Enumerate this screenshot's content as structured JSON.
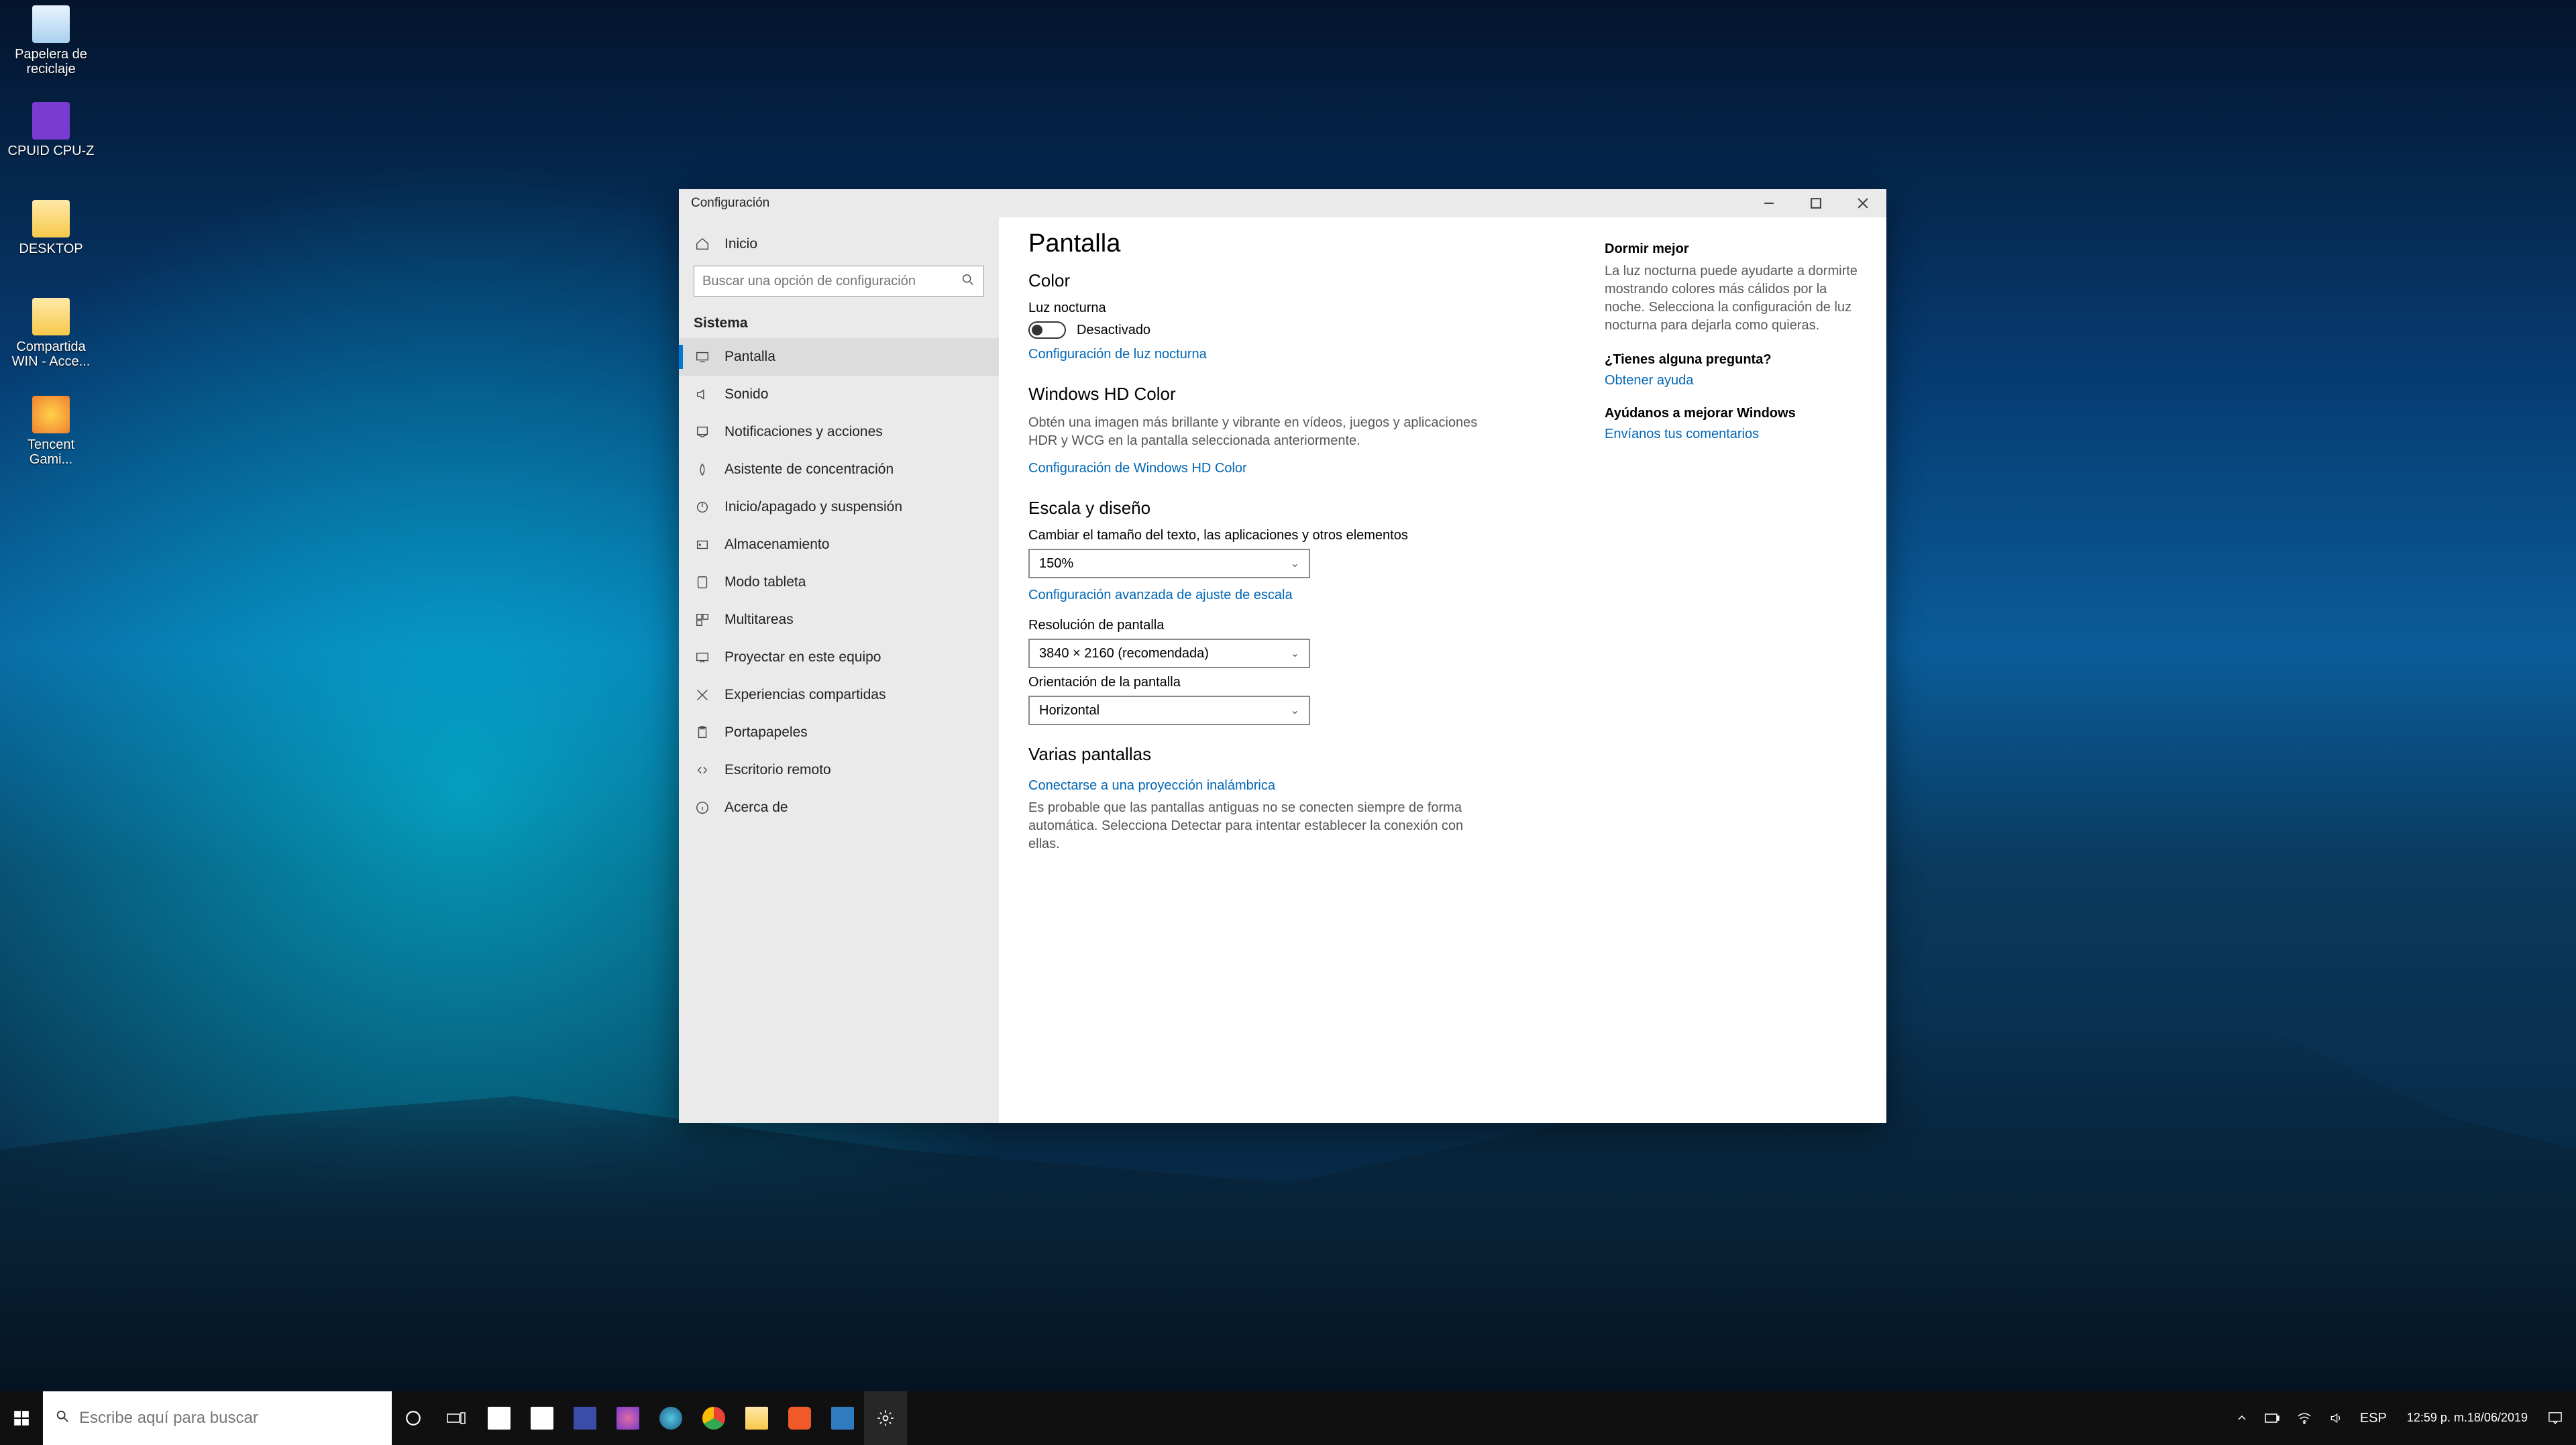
{
  "desktop_icons": [
    {
      "label": "Papelera de reciclaje",
      "color": "#cfe8ff"
    },
    {
      "label": "CPUID CPU-Z",
      "color": "#7a3bd1"
    },
    {
      "label": "DESKTOP",
      "color": "#ffe27a"
    },
    {
      "label": "Compartida WIN - Acce...",
      "color": "#ffe27a"
    },
    {
      "label": "Tencent Gami...",
      "color": "#ffb030"
    }
  ],
  "window": {
    "title": "Configuración",
    "home": "Inicio",
    "search_placeholder": "Buscar una opción de configuración",
    "section": "Sistema",
    "nav": [
      "Pantalla",
      "Sonido",
      "Notificaciones y acciones",
      "Asistente de concentración",
      "Inicio/apagado y suspensión",
      "Almacenamiento",
      "Modo tableta",
      "Multitareas",
      "Proyectar en este equipo",
      "Experiencias compartidas",
      "Portapapeles",
      "Escritorio remoto",
      "Acerca de"
    ],
    "page": {
      "title": "Pantalla",
      "color_h": "Color",
      "nightlight_label": "Luz nocturna",
      "nightlight_state": "Desactivado",
      "nightlight_link": "Configuración de luz nocturna",
      "hd_h": "Windows HD Color",
      "hd_desc": "Obtén una imagen más brillante y vibrante en vídeos, juegos y aplicaciones HDR y WCG en la pantalla seleccionada anteriormente.",
      "hd_link": "Configuración de Windows HD Color",
      "scale_h": "Escala y diseño",
      "scale_label": "Cambiar el tamaño del texto, las aplicaciones y otros elementos",
      "scale_value": "150%",
      "scale_link": "Configuración avanzada de ajuste de escala",
      "res_label": "Resolución de pantalla",
      "res_value": "3840 × 2160 (recomendada)",
      "orient_label": "Orientación de la pantalla",
      "orient_value": "Horizontal",
      "multi_h": "Varias pantallas",
      "multi_link": "Conectarse a una proyección inalámbrica",
      "multi_desc": "Es probable que las pantallas antiguas no se conecten siempre de forma automática. Selecciona Detectar para intentar establecer la conexión con ellas."
    },
    "aside": {
      "sleep_h": "Dormir mejor",
      "sleep_p": "La luz nocturna puede ayudarte a dormirte mostrando colores más cálidos por la noche. Selecciona la configuración de luz nocturna para dejarla como quieras.",
      "q_h": "¿Tienes alguna pregunta?",
      "q_link": "Obtener ayuda",
      "fb_h": "Ayúdanos a mejorar Windows",
      "fb_link": "Envíanos tus comentarios"
    }
  },
  "taskbar": {
    "search_placeholder": "Escribe aquí para buscar",
    "lang": "ESP",
    "time": "12:59 p. m.",
    "date": "18/06/2019",
    "apps": [
      {
        "name": "store",
        "color": "#ffffff"
      },
      {
        "name": "mail",
        "color": "#ffffff"
      },
      {
        "name": "live",
        "color": "#3a4da8"
      },
      {
        "name": "paint",
        "color": "#e06aa0"
      },
      {
        "name": "edge",
        "color": "#57c6e1"
      },
      {
        "name": "chrome",
        "color": "#f2c14e"
      },
      {
        "name": "explorer",
        "color": "#f7d774"
      },
      {
        "name": "brave",
        "color": "#f05a28"
      },
      {
        "name": "teamviewer",
        "color": "#2f7bbf"
      },
      {
        "name": "settings",
        "color": "#d0d0d0"
      }
    ]
  }
}
